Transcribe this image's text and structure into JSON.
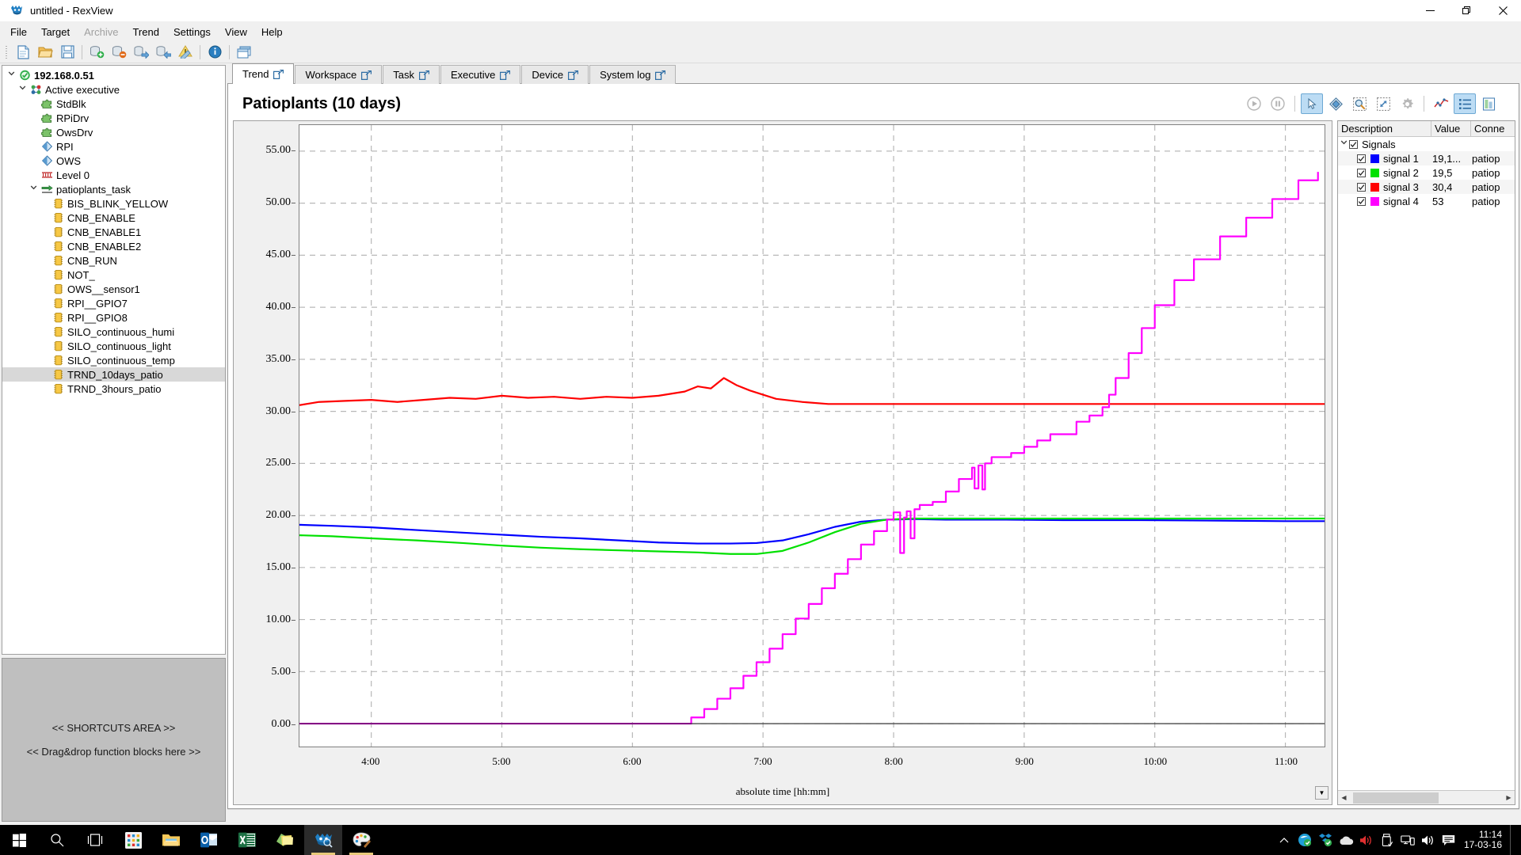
{
  "window": {
    "title": "untitled - RexView",
    "app_icon": "rexview-logo-icon",
    "minimize": "–",
    "maximize": "❐",
    "close": "✕"
  },
  "menu": {
    "items": [
      {
        "label": "File",
        "disabled": false
      },
      {
        "label": "Target",
        "disabled": false
      },
      {
        "label": "Archive",
        "disabled": true
      },
      {
        "label": "Trend",
        "disabled": false
      },
      {
        "label": "Settings",
        "disabled": false
      },
      {
        "label": "View",
        "disabled": false
      },
      {
        "label": "Help",
        "disabled": false
      }
    ]
  },
  "toolbar": {
    "buttons": [
      {
        "name": "new-file-icon"
      },
      {
        "name": "open-file-icon"
      },
      {
        "name": "save-file-icon"
      },
      {
        "name": "connect-device-icon"
      },
      {
        "name": "disconnect-device-icon"
      },
      {
        "name": "download-icon"
      },
      {
        "name": "upload-icon"
      },
      {
        "name": "diagnostics-icon"
      },
      {
        "name": "info-icon"
      },
      {
        "name": "window-icon"
      }
    ]
  },
  "tree": {
    "nodes": [
      {
        "label": "192.168.0.51",
        "indent": 0,
        "chevron": "v",
        "icon": "connected-target-icon",
        "bold": true,
        "selected": false
      },
      {
        "label": "Active executive",
        "indent": 1,
        "chevron": "v",
        "icon": "executive-icon",
        "bold": false,
        "selected": false
      },
      {
        "label": "StdBlk",
        "indent": 2,
        "chevron": "",
        "icon": "library-icon",
        "bold": false,
        "selected": false
      },
      {
        "label": "RPiDrv",
        "indent": 2,
        "chevron": "",
        "icon": "library-icon",
        "bold": false,
        "selected": false
      },
      {
        "label": "OwsDrv",
        "indent": 2,
        "chevron": "",
        "icon": "library-icon",
        "bold": false,
        "selected": false
      },
      {
        "label": "RPI",
        "indent": 2,
        "chevron": "",
        "icon": "driver-icon",
        "bold": false,
        "selected": false
      },
      {
        "label": "OWS",
        "indent": 2,
        "chevron": "",
        "icon": "driver-icon",
        "bold": false,
        "selected": false
      },
      {
        "label": "Level 0",
        "indent": 2,
        "chevron": "",
        "icon": "level-icon",
        "bold": false,
        "selected": false
      },
      {
        "label": "patioplants_task",
        "indent": 2,
        "chevron": "v",
        "icon": "task-icon",
        "bold": false,
        "selected": false
      },
      {
        "label": "BIS_BLINK_YELLOW",
        "indent": 3,
        "chevron": "",
        "icon": "function-block-icon",
        "bold": false,
        "selected": false
      },
      {
        "label": "CNB_ENABLE",
        "indent": 3,
        "chevron": "",
        "icon": "function-block-icon",
        "bold": false,
        "selected": false
      },
      {
        "label": "CNB_ENABLE1",
        "indent": 3,
        "chevron": "",
        "icon": "function-block-icon",
        "bold": false,
        "selected": false
      },
      {
        "label": "CNB_ENABLE2",
        "indent": 3,
        "chevron": "",
        "icon": "function-block-icon",
        "bold": false,
        "selected": false
      },
      {
        "label": "CNB_RUN",
        "indent": 3,
        "chevron": "",
        "icon": "function-block-icon",
        "bold": false,
        "selected": false
      },
      {
        "label": "NOT_",
        "indent": 3,
        "chevron": "",
        "icon": "function-block-icon",
        "bold": false,
        "selected": false
      },
      {
        "label": "OWS__sensor1",
        "indent": 3,
        "chevron": "",
        "icon": "function-block-icon",
        "bold": false,
        "selected": false
      },
      {
        "label": "RPI__GPIO7",
        "indent": 3,
        "chevron": "",
        "icon": "function-block-icon",
        "bold": false,
        "selected": false
      },
      {
        "label": "RPI__GPIO8",
        "indent": 3,
        "chevron": "",
        "icon": "function-block-icon",
        "bold": false,
        "selected": false
      },
      {
        "label": "SILO_continuous_humi",
        "indent": 3,
        "chevron": "",
        "icon": "function-block-icon",
        "bold": false,
        "selected": false
      },
      {
        "label": "SILO_continuous_light",
        "indent": 3,
        "chevron": "",
        "icon": "function-block-icon",
        "bold": false,
        "selected": false
      },
      {
        "label": "SILO_continuous_temp",
        "indent": 3,
        "chevron": "",
        "icon": "function-block-icon",
        "bold": false,
        "selected": false
      },
      {
        "label": "TRND_10days_patio",
        "indent": 3,
        "chevron": "",
        "icon": "function-block-icon",
        "bold": false,
        "selected": true
      },
      {
        "label": "TRND_3hours_patio",
        "indent": 3,
        "chevron": "",
        "icon": "function-block-icon",
        "bold": false,
        "selected": false
      }
    ]
  },
  "shortcuts": {
    "line1": "<< SHORTCUTS AREA >>",
    "line2": "<< Drag&drop function blocks here >>"
  },
  "tabs": [
    {
      "label": "Trend",
      "active": true
    },
    {
      "label": "Workspace",
      "active": false
    },
    {
      "label": "Task",
      "active": false
    },
    {
      "label": "Executive",
      "active": false
    },
    {
      "label": "Device",
      "active": false
    },
    {
      "label": "System log",
      "active": false
    }
  ],
  "chart_toolbar": {
    "buttons": [
      {
        "name": "play-button",
        "active": false,
        "disabled": true
      },
      {
        "name": "pause-button",
        "active": false,
        "disabled": true
      },
      {
        "name": "select-tool-button",
        "active": true,
        "disabled": false
      },
      {
        "name": "pan-tool-button",
        "active": false,
        "disabled": false
      },
      {
        "name": "zoom-tool-button",
        "active": false,
        "disabled": false
      },
      {
        "name": "zoom-fit-button",
        "active": false,
        "disabled": false
      },
      {
        "name": "settings-button",
        "active": false,
        "disabled": false
      },
      {
        "name": "signal-properties-button",
        "active": false,
        "disabled": false
      },
      {
        "name": "legend-toggle-button",
        "active": true,
        "disabled": false
      },
      {
        "name": "export-data-button",
        "active": false,
        "disabled": false
      }
    ]
  },
  "legend": {
    "columns": [
      "Description",
      "Value",
      "Conne"
    ],
    "group": {
      "label": "Signals",
      "checked": true,
      "expanded": true
    },
    "rows": [
      {
        "label": "signal 1",
        "value": "19,1...",
        "connection": "patiop",
        "color": "#0000ff",
        "checked": true
      },
      {
        "label": "signal 2",
        "value": "19,5",
        "connection": "patiop",
        "color": "#00e000",
        "checked": true
      },
      {
        "label": "signal 3",
        "value": "30,4",
        "connection": "patiop",
        "color": "#ff0000",
        "checked": true
      },
      {
        "label": "signal 4",
        "value": "53",
        "connection": "patiop",
        "color": "#ff00ff",
        "checked": true
      }
    ]
  },
  "chart_data": {
    "type": "line",
    "title": "Patioplants (10 days)",
    "xlabel": "absolute time [hh:mm]",
    "ylabel": "",
    "grid": true,
    "legend_position": "right",
    "xtick_labels": [
      "4:00",
      "5:00",
      "6:00",
      "7:00",
      "8:00",
      "9:00",
      "10:00",
      "11:00"
    ],
    "xtick_values": [
      4,
      5,
      6,
      7,
      8,
      9,
      10,
      11
    ],
    "xlim": [
      3.45,
      11.3
    ],
    "ytick_labels": [
      "0.00",
      "5.00",
      "10.00",
      "15.00",
      "20.00",
      "25.00",
      "30.00",
      "35.00",
      "40.00",
      "45.00",
      "50.00",
      "55.00"
    ],
    "ylim": [
      -2.2,
      57.5
    ],
    "series": [
      {
        "name": "signal 1",
        "color": "#0000ff",
        "x": [
          3.45,
          3.7,
          4.0,
          4.35,
          4.7,
          5.0,
          5.3,
          5.6,
          5.9,
          6.2,
          6.5,
          6.75,
          6.95,
          7.15,
          7.35,
          7.55,
          7.75,
          7.95,
          8.15,
          8.4,
          8.8,
          9.3,
          9.9,
          10.5,
          11.0,
          11.3
        ],
        "y": [
          19.1,
          19.0,
          18.85,
          18.6,
          18.35,
          18.15,
          17.95,
          17.8,
          17.6,
          17.4,
          17.3,
          17.3,
          17.35,
          17.6,
          18.2,
          18.9,
          19.4,
          19.6,
          19.65,
          19.6,
          19.6,
          19.55,
          19.55,
          19.5,
          19.45,
          19.45
        ]
      },
      {
        "name": "signal 2",
        "color": "#00e000",
        "x": [
          3.45,
          3.7,
          4.0,
          4.35,
          4.7,
          5.0,
          5.3,
          5.6,
          5.9,
          6.2,
          6.5,
          6.75,
          6.95,
          7.15,
          7.35,
          7.55,
          7.75,
          7.95,
          8.15,
          8.4,
          8.8,
          9.3,
          9.9,
          10.5,
          11.0,
          11.3
        ],
        "y": [
          18.1,
          18.0,
          17.8,
          17.6,
          17.35,
          17.1,
          16.9,
          16.75,
          16.65,
          16.55,
          16.45,
          16.3,
          16.3,
          16.6,
          17.4,
          18.4,
          19.2,
          19.6,
          19.7,
          19.7,
          19.7,
          19.7,
          19.7,
          19.7,
          19.7,
          19.7
        ]
      },
      {
        "name": "signal 3",
        "color": "#ff0000",
        "x": [
          3.45,
          3.6,
          3.8,
          4.0,
          4.2,
          4.4,
          4.6,
          4.8,
          5.0,
          5.2,
          5.4,
          5.6,
          5.8,
          6.0,
          6.2,
          6.4,
          6.5,
          6.6,
          6.7,
          6.8,
          6.9,
          7.0,
          7.1,
          7.3,
          7.5,
          7.7,
          7.9,
          8.1,
          8.3,
          11.3
        ],
        "y": [
          30.6,
          30.9,
          31.0,
          31.1,
          30.9,
          31.1,
          31.3,
          31.2,
          31.5,
          31.3,
          31.4,
          31.2,
          31.4,
          31.3,
          31.5,
          31.9,
          32.4,
          32.2,
          33.2,
          32.5,
          32.0,
          31.6,
          31.2,
          30.9,
          30.7,
          30.7,
          30.7,
          30.7,
          30.7,
          30.7
        ]
      },
      {
        "name": "signal 4",
        "color": "#ff00ff",
        "x": [
          3.45,
          6.35,
          6.45,
          6.55,
          6.65,
          6.75,
          6.85,
          6.95,
          7.05,
          7.15,
          7.25,
          7.35,
          7.45,
          7.55,
          7.65,
          7.75,
          7.85,
          7.95,
          8.0,
          8.05,
          8.08,
          8.1,
          8.13,
          8.16,
          8.2,
          8.3,
          8.4,
          8.5,
          8.6,
          8.62,
          8.65,
          8.68,
          8.7,
          8.75,
          8.8,
          8.85,
          8.9,
          9.0,
          9.1,
          9.2,
          9.4,
          9.5,
          9.6,
          9.65,
          9.7,
          9.8,
          9.9,
          10.0,
          10.15,
          10.3,
          10.5,
          10.7,
          10.9,
          11.1,
          11.25
        ],
        "y": [
          0,
          0,
          0.6,
          1.4,
          2.4,
          3.4,
          4.6,
          5.9,
          7.2,
          8.6,
          10.1,
          11.5,
          13.0,
          14.4,
          15.8,
          17.2,
          18.5,
          19.6,
          20.3,
          16.4,
          19.8,
          20.4,
          17.8,
          20.6,
          21.0,
          21.3,
          22.3,
          23.5,
          24.6,
          22.6,
          24.8,
          22.5,
          25.0,
          25.6,
          25.6,
          25.6,
          26.0,
          26.6,
          27.2,
          27.8,
          29.0,
          29.6,
          30.4,
          31.6,
          33.2,
          35.6,
          38.0,
          40.2,
          42.6,
          44.6,
          46.8,
          48.6,
          50.4,
          52.2,
          53.0
        ]
      }
    ]
  },
  "taskbar": {
    "items": [
      {
        "name": "start-button"
      },
      {
        "name": "search-button"
      },
      {
        "name": "task-view-button"
      },
      {
        "name": "app-grid-icon"
      },
      {
        "name": "file-explorer-icon"
      },
      {
        "name": "outlook-icon"
      },
      {
        "name": "excel-icon"
      },
      {
        "name": "sticky-notes-icon"
      },
      {
        "name": "rexview-icon"
      },
      {
        "name": "paint-icon"
      }
    ],
    "tray": [
      {
        "name": "show-hidden-icons-icon"
      },
      {
        "name": "browser-icon"
      },
      {
        "name": "dropbox-icon"
      },
      {
        "name": "onedrive-icon"
      },
      {
        "name": "volume-mute-icon"
      },
      {
        "name": "usb-eject-icon"
      },
      {
        "name": "network-icon"
      },
      {
        "name": "volume-icon"
      },
      {
        "name": "action-center-icon"
      }
    ],
    "clock_time": "11:14",
    "clock_date": "17-03-16"
  }
}
